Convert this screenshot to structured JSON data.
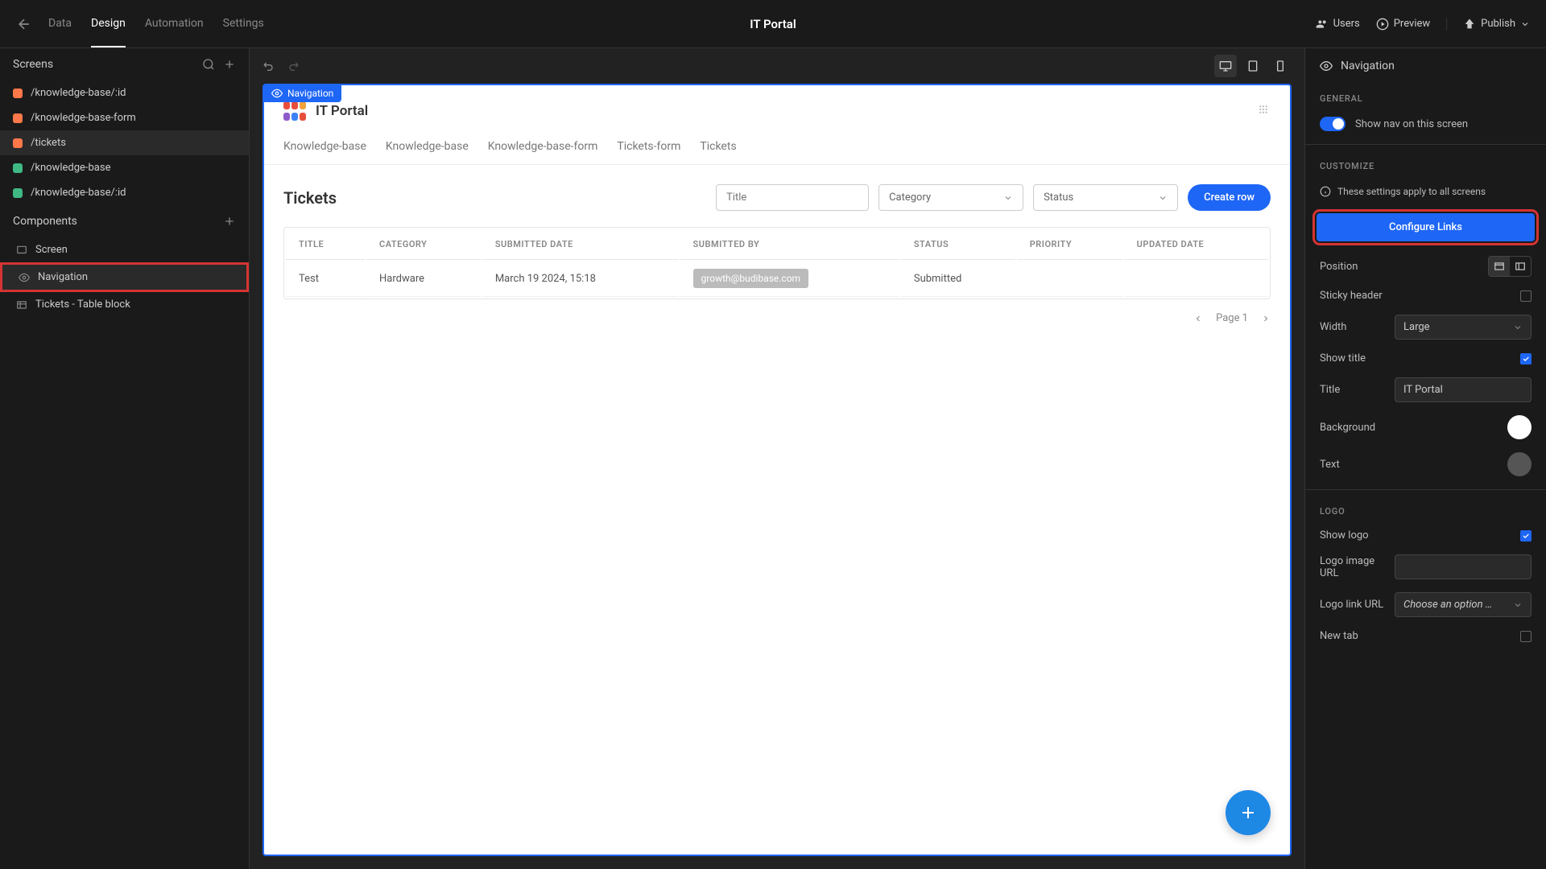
{
  "header": {
    "app_title": "IT Portal",
    "tabs": {
      "data": "Data",
      "design": "Design",
      "automation": "Automation",
      "settings": "Settings"
    },
    "actions": {
      "users": "Users",
      "preview": "Preview",
      "publish": "Publish"
    }
  },
  "sidebar": {
    "screens_label": "Screens",
    "screens": [
      {
        "path": "/knowledge-base/:id",
        "color": "orange"
      },
      {
        "path": "/knowledge-base-form",
        "color": "orange"
      },
      {
        "path": "/tickets",
        "color": "orange",
        "selected": true
      },
      {
        "path": "/knowledge-base",
        "color": "green"
      },
      {
        "path": "/knowledge-base/:id",
        "color": "green"
      }
    ],
    "components_label": "Components",
    "components": [
      {
        "name": "Screen",
        "icon": "screen"
      },
      {
        "name": "Navigation",
        "icon": "eye",
        "highlighted": true
      },
      {
        "name": "Tickets - Table block",
        "icon": "table"
      }
    ]
  },
  "preview": {
    "badge": "Navigation",
    "app_name": "IT Portal",
    "nav_items": [
      "Knowledge-base",
      "Knowledge-base",
      "Knowledge-base-form",
      "Tickets-form",
      "Tickets"
    ],
    "page_title": "Tickets",
    "filters": {
      "title_placeholder": "Title",
      "category_label": "Category",
      "status_label": "Status"
    },
    "create_btn": "Create row",
    "columns": [
      "TITLE",
      "CATEGORY",
      "SUBMITTED DATE",
      "SUBMITTED BY",
      "STATUS",
      "PRIORITY",
      "UPDATED DATE"
    ],
    "rows": [
      {
        "title": "Test",
        "category": "Hardware",
        "submitted_date": "March 19 2024, 15:18",
        "submitted_by": "growth@budibase.com",
        "status": "Submitted",
        "priority": "",
        "updated_date": ""
      }
    ],
    "pagination": "Page 1"
  },
  "inspector": {
    "title": "Navigation",
    "general_label": "GENERAL",
    "show_nav": "Show nav on this screen",
    "customize_label": "CUSTOMIZE",
    "info_text": "These settings apply to all screens",
    "configure_links": "Configure Links",
    "position_label": "Position",
    "sticky_label": "Sticky header",
    "width_label": "Width",
    "width_value": "Large",
    "show_title_label": "Show title",
    "title_label": "Title",
    "title_value": "IT Portal",
    "background_label": "Background",
    "text_label": "Text",
    "logo_label": "LOGO",
    "show_logo_label": "Show logo",
    "logo_url_label": "Logo image URL",
    "logo_link_label": "Logo link URL",
    "logo_link_value": "Choose an option …",
    "new_tab_label": "New tab"
  }
}
